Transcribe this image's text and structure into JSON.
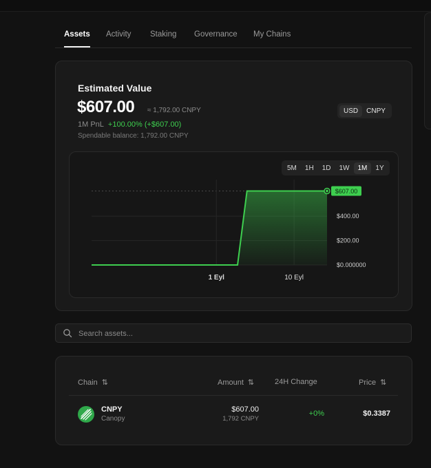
{
  "tabs": [
    "Assets",
    "Activity",
    "Staking",
    "Governance",
    "My Chains"
  ],
  "active_tab": "Assets",
  "estimated": {
    "title": "Estimated Value",
    "amount": "$607.00",
    "approx": "≈ 1,792.00 CNPY",
    "pnl_label": "1M PnL",
    "pnl_value": "+100.00% (+$607.00)",
    "spendable": "Spendable balance: 1,792.00 CNPY",
    "currencies": [
      "USD",
      "CNPY"
    ],
    "selected_currency": "USD"
  },
  "ranges": [
    "5M",
    "1H",
    "1D",
    "1W",
    "1M",
    "1Y"
  ],
  "selected_range": "1M",
  "chart_data": {
    "type": "area",
    "x_tick_labels": [
      "1 Eyl",
      "10 Eyl"
    ],
    "y_tick_labels": [
      "$400.00",
      "$200.00",
      "$0.000000"
    ],
    "current_label": "$607.00",
    "ylim": [
      0,
      700
    ],
    "points": [
      [
        0,
        0
      ],
      [
        62,
        0
      ],
      [
        66,
        607
      ],
      [
        100,
        607
      ]
    ],
    "color": "#3ecf4f",
    "grid": true
  },
  "search": {
    "placeholder": "Search assets..."
  },
  "table": {
    "headers": {
      "chain": "Chain",
      "amount": "Amount",
      "change": "24H Change",
      "price": "Price"
    },
    "rows": [
      {
        "symbol": "CNPY",
        "name": "Canopy",
        "amount": "$607.00",
        "amount_sub": "1,792 CNPY",
        "change": "+0%",
        "price": "$0.3387"
      }
    ]
  },
  "colors": {
    "accent": "#3ecf4f",
    "background": "#121212",
    "card": "#1a1a1a"
  }
}
